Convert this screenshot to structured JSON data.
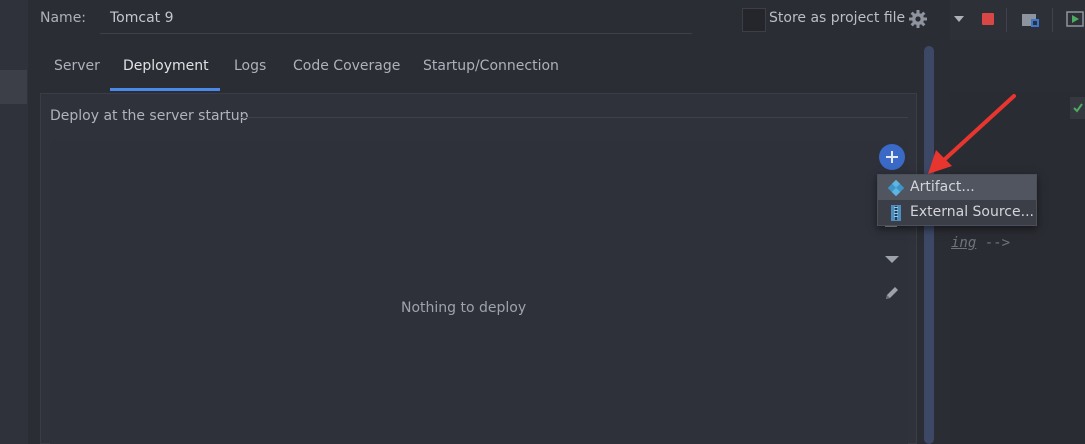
{
  "header": {
    "name_label": "Name:",
    "name_value": "Tomcat 9",
    "store_label": "Store as project file"
  },
  "tabs": [
    {
      "label": "Server",
      "active": false
    },
    {
      "label": "Deployment",
      "active": true
    },
    {
      "label": "Logs",
      "active": false
    },
    {
      "label": "Code Coverage",
      "active": false
    },
    {
      "label": "Startup/Connection",
      "active": false
    }
  ],
  "deployment": {
    "group_title": "Deploy at the server startup",
    "empty_text": "Nothing to deploy"
  },
  "add_menu": {
    "items": [
      {
        "label": "Artifact...",
        "icon": "artifact-icon",
        "selected": true
      },
      {
        "label": "External Source...",
        "icon": "external-source-icon",
        "selected": false
      }
    ]
  },
  "editor": {
    "code_word": "ing",
    "code_arrow": " -->"
  },
  "colors": {
    "accent": "#4b89e8",
    "add_button": "#3a69c8",
    "stop": "#d94646",
    "annotation_arrow": "#e8362f"
  }
}
